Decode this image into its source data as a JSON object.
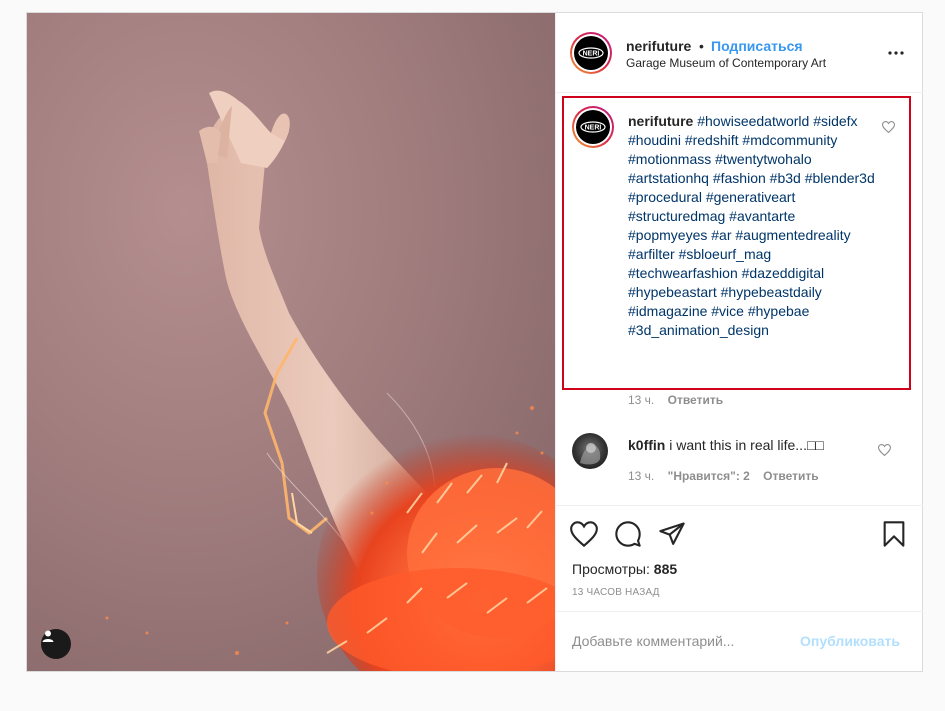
{
  "post": {
    "author": "nerifuture",
    "separator": "•",
    "follow_label": "Подписаться",
    "location": "Garage Museum of Contemporary Art",
    "avatar_text": "NERI"
  },
  "caption": {
    "username": "nerifuture",
    "hashtags": "#howiseedatworld #sidefx #houdini #redshift #mdcommunity #motionmass #twentytwohalo #artstationhq #fashion #b3d #blender3d #procedural #generativeart #structuredmag #avantarte #popmyeyes #ar #augmentedreality #arfilter #sbloeurf_mag #techwearfashion #dazeddigital #hypebeastart #hypebeastdaily #idmagazine #vice #hypebae #3d_animation_design",
    "time": "13 ч.",
    "reply_label": "Ответить"
  },
  "comment": {
    "username": "k0ffin",
    "text": "i want this in real life...□□",
    "time": "13 ч.",
    "likes": "\"Нравится\": 2",
    "reply_label": "Ответить"
  },
  "stats": {
    "views_label": "Просмотры:",
    "views_value": "885",
    "time_ago": "13 часов назад"
  },
  "composer": {
    "placeholder": "Добавьте комментарий...",
    "publish_label": "Опубликовать"
  },
  "icons": {
    "like": "heart-icon",
    "comment": "comment-bubble-icon",
    "share": "paper-plane-icon",
    "save": "bookmark-icon",
    "more": "more-dots-icon",
    "user_tag": "user-icon"
  },
  "colors": {
    "link_blue": "#3897f0",
    "hashtag_navy": "#003569",
    "highlight_red": "#d0021b",
    "muted_gray": "#8e8e8e",
    "publish_disabled": "#b2dffc"
  }
}
